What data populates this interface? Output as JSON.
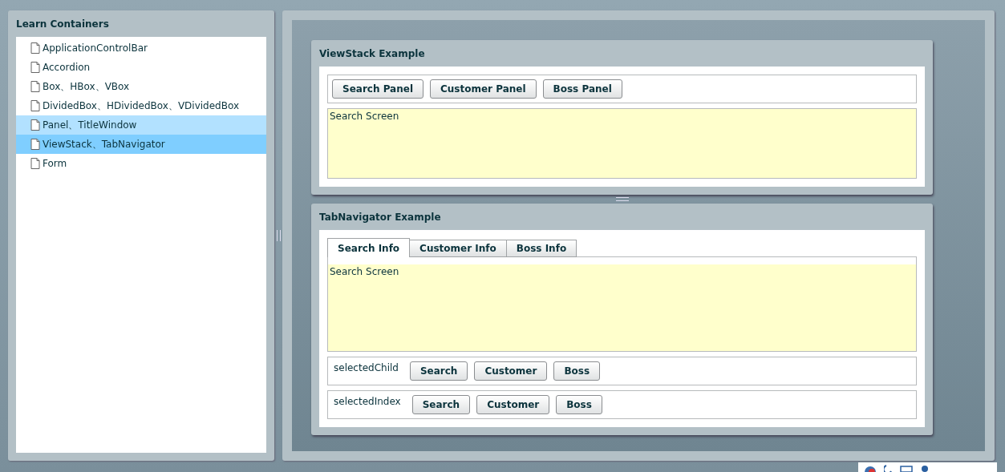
{
  "sidebar": {
    "title": "Learn Containers",
    "items": [
      {
        "label": "ApplicationControlBar",
        "selected": false,
        "hovered": false
      },
      {
        "label": "Accordion",
        "selected": false,
        "hovered": false
      },
      {
        "label": "Box、HBox、VBox",
        "selected": false,
        "hovered": false
      },
      {
        "label": "DividedBox、HDividedBox、VDividedBox",
        "selected": false,
        "hovered": false
      },
      {
        "label": "Panel、TitleWindow",
        "selected": false,
        "hovered": true
      },
      {
        "label": "ViewStack、TabNavigator",
        "selected": true,
        "hovered": false
      },
      {
        "label": "Form",
        "selected": false,
        "hovered": false
      }
    ]
  },
  "viewstack": {
    "title": "ViewStack Example",
    "buttons": [
      "Search Panel",
      "Customer Panel",
      "Boss Panel"
    ],
    "content": "Search Screen"
  },
  "tabnavigator": {
    "title": "TabNavigator Example",
    "tabs": [
      {
        "label": "Search Info",
        "selected": true
      },
      {
        "label": "Customer Info",
        "selected": false
      },
      {
        "label": "Boss Info",
        "selected": false
      }
    ],
    "content": "Search Screen",
    "rows": [
      {
        "label": "selectedChild",
        "buttons": [
          "Search",
          "Customer",
          "Boss"
        ]
      },
      {
        "label": "selectedIndex",
        "buttons": [
          "Search",
          "Customer",
          "Boss"
        ]
      }
    ]
  }
}
